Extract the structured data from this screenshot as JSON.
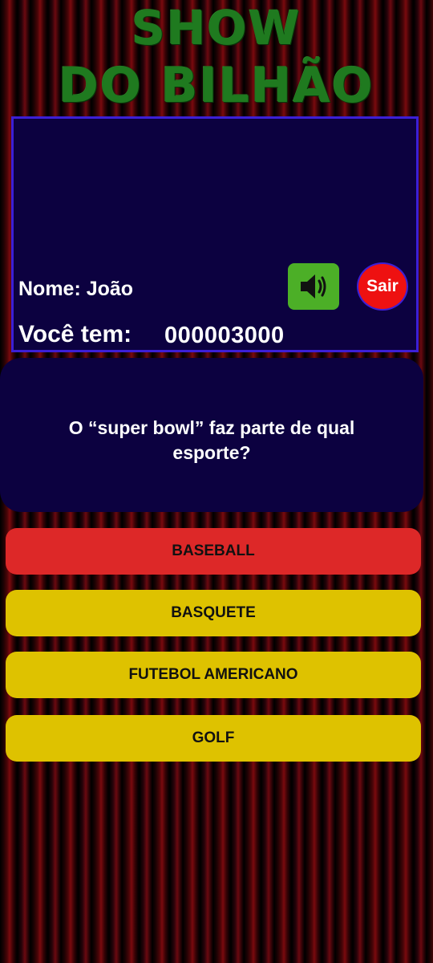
{
  "app": {
    "title_line1": "SHOW",
    "title_line2": "DO BILHÃO"
  },
  "player": {
    "name_text": "Nome: João",
    "money_label": "Você tem:",
    "money_value": "000003000"
  },
  "controls": {
    "sound_icon": "speaker-icon",
    "exit_label": "Sair"
  },
  "question": {
    "text": "O “super bowl” faz parte de qual esporte?"
  },
  "answers": [
    {
      "label": "BASEBALL",
      "color": "#dd2828"
    },
    {
      "label": "BASQUETE",
      "color": "#dec200"
    },
    {
      "label": "FUTEBOL AMERICANO",
      "color": "#dec200"
    },
    {
      "label": "GOLF",
      "color": "#dec200"
    }
  ],
  "colors": {
    "panel": "#0c0140",
    "panel_border": "#3c1fd6",
    "title_green": "#1f7a1f",
    "sound_green": "#4caf27",
    "exit_red": "#ee1111",
    "selected_answer": "#dd2828",
    "answer_default": "#dec200"
  }
}
